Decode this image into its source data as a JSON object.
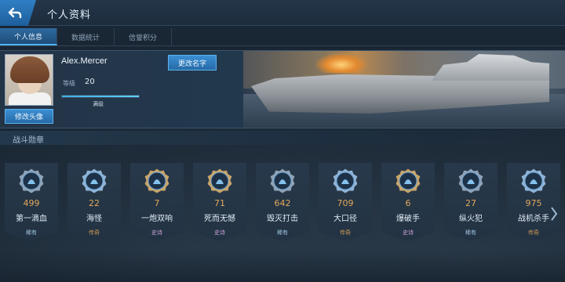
{
  "header": {
    "title": "个人资料",
    "back_icon": "back-arrow-icon"
  },
  "tabs": [
    {
      "label": "个人信息",
      "active": true
    },
    {
      "label": "数据统计",
      "active": false
    },
    {
      "label": "信誉积分",
      "active": false
    }
  ],
  "profile": {
    "username": "Alex.Mercer",
    "level_label": "等级",
    "level_value": "20",
    "level_progress": 1.0,
    "level_max_text": "满级",
    "change_avatar_label": "修改头像",
    "change_name_label": "更改名字"
  },
  "section": {
    "title": "战斗勋章"
  },
  "medals": [
    {
      "count": "499",
      "name": "第一滴血",
      "rarity": "稀有",
      "rarity_type": "rare",
      "icon": "drop-icon",
      "frame": "#8fa3b8"
    },
    {
      "count": "22",
      "name": "海怪",
      "rarity": "传奇",
      "rarity_type": "legend",
      "icon": "kraken-icon",
      "frame": "#8fb4d8"
    },
    {
      "count": "7",
      "name": "一炮双响",
      "rarity": "史诗",
      "rarity_type": "epic",
      "icon": "double-shot-icon",
      "frame": "#c9a56a"
    },
    {
      "count": "71",
      "name": "死而无憾",
      "rarity": "史诗",
      "rarity_type": "epic",
      "icon": "last-stand-icon",
      "frame": "#c9a56a"
    },
    {
      "count": "642",
      "name": "毁灭打击",
      "rarity": "稀有",
      "rarity_type": "rare",
      "icon": "strike-icon",
      "frame": "#8fa3b8"
    },
    {
      "count": "709",
      "name": "大口径",
      "rarity": "传奇",
      "rarity_type": "legend",
      "icon": "caliber-icon",
      "frame": "#8fb4d8"
    },
    {
      "count": "6",
      "name": "爆破手",
      "rarity": "史诗",
      "rarity_type": "epic",
      "icon": "demolition-icon",
      "frame": "#c9a56a"
    },
    {
      "count": "27",
      "name": "纵火犯",
      "rarity": "稀有",
      "rarity_type": "rare",
      "icon": "fire-icon",
      "frame": "#8fa3b8"
    },
    {
      "count": "975",
      "name": "战机杀手",
      "rarity": "传奇",
      "rarity_type": "legend",
      "icon": "plane-killer-icon",
      "frame": "#8fb4d8"
    }
  ],
  "colors": {
    "accent_blue": "#2f7fc4",
    "count_orange": "#e2a85a",
    "rare": "#9fc3e0",
    "legend": "#d49b55",
    "epic": "#c9a0d8"
  }
}
